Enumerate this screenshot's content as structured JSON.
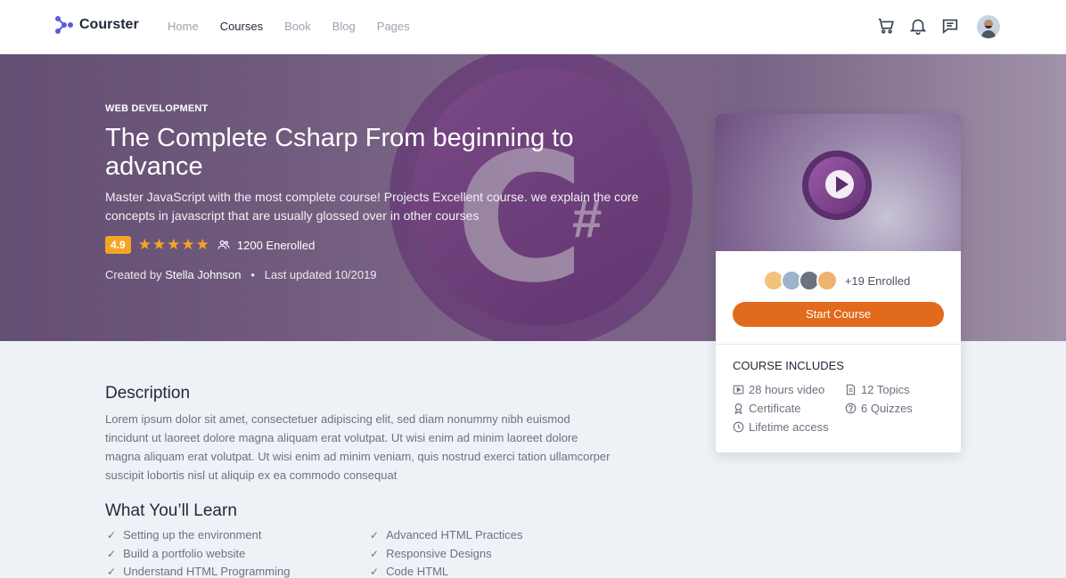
{
  "brand": {
    "name": "Courster",
    "accent": "#5b5bd6"
  },
  "nav": {
    "items": [
      "Home",
      "Courses",
      "Book",
      "Blog",
      "Pages"
    ],
    "active": "Courses"
  },
  "header_icons": [
    "cart-icon",
    "bell-icon",
    "chat-icon"
  ],
  "hero": {
    "category": "WEB DEVELOPMENT",
    "title": "The Complete Csharp From beginning to advance",
    "subtitle": "Master JavaScript with the most complete course! Projects Excellent course. we explain the core concepts in javascript that are usually glossed over in other courses",
    "rating": "4.9",
    "stars": "★★★★★",
    "enrolled": "1200 Enerolled",
    "created_prefix": "Created by",
    "author": "Stella Johnson",
    "separator": "•",
    "updated": "Last updated 10/2019"
  },
  "card": {
    "enrolled": "+19 Enrolled",
    "start_button": "Start Course",
    "includes_title": "COURSE INCLUDES",
    "includes": [
      {
        "label": "28 hours video",
        "icon": "video-icon"
      },
      {
        "label": "12 Topics",
        "icon": "document-icon"
      },
      {
        "label": "Certificate",
        "icon": "award-icon"
      },
      {
        "label": "6 Quizzes",
        "icon": "question-icon"
      },
      {
        "label": "Lifetime access",
        "icon": "clock-icon"
      }
    ],
    "button_color": "#e26a1d"
  },
  "description": {
    "heading": "Description",
    "text": "Lorem ipsum dolor sit amet, consectetuer adipiscing elit, sed diam nonummy nibh euismod tincidunt ut laoreet dolore magna aliquam erat volutpat. Ut wisi enim ad minim laoreet dolore magna aliquam erat volutpat. Ut wisi enim ad minim veniam, quis nostrud exerci tation ullamcorper suscipit lobortis nisl ut aliquip ex ea commodo consequat"
  },
  "learn": {
    "heading": "What You’ll Learn",
    "items": [
      "Setting up the environment",
      "Advanced HTML Practices",
      "Build a portfolio website",
      "Responsive Designs",
      "Understand HTML Programming",
      "Code HTML"
    ]
  }
}
